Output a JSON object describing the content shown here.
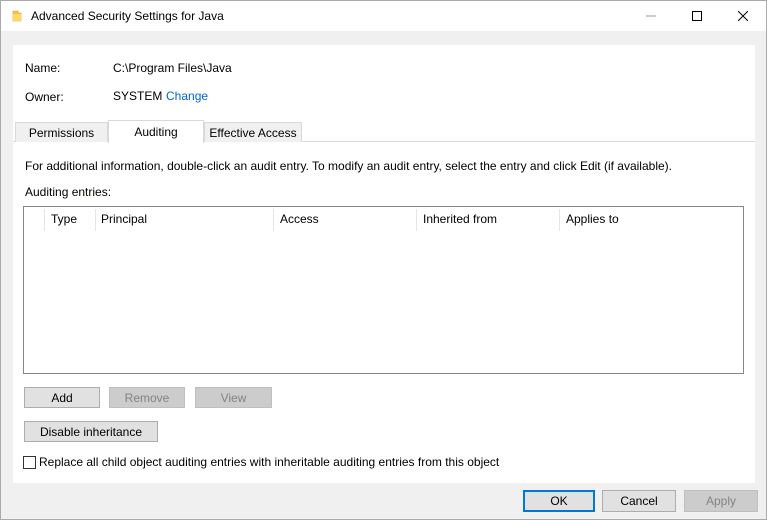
{
  "window": {
    "title": "Advanced Security Settings for Java",
    "minimize_glyph": "—",
    "maximize_glyph": "☐",
    "close_glyph": "✕"
  },
  "info": {
    "name_label": "Name:",
    "name_value": "C:\\Program Files\\Java",
    "owner_label": "Owner:",
    "owner_value": "SYSTEM",
    "change_link": "Change"
  },
  "tabs": [
    {
      "label": "Permissions",
      "active": false
    },
    {
      "label": "Auditing",
      "active": true
    },
    {
      "label": "Effective Access",
      "active": false
    }
  ],
  "auditing": {
    "info_text": "For additional information, double-click an audit entry. To modify an audit entry, select the entry and click Edit (if available).",
    "entries_label": "Auditing entries:",
    "columns": [
      "Type",
      "Principal",
      "Access",
      "Inherited from",
      "Applies to"
    ],
    "rows": []
  },
  "buttons": {
    "add": "Add",
    "remove": "Remove",
    "view": "View",
    "disable_inheritance": "Disable inheritance",
    "ok": "OK",
    "cancel": "Cancel",
    "apply": "Apply"
  },
  "replace_checkbox": {
    "label": "Replace all child object auditing entries with inheritable auditing entries from this object",
    "checked": false
  },
  "colors": {
    "link": "#0066cc",
    "default_button_border": "#0078d7"
  },
  "icons": {
    "title": "folder-icon"
  }
}
